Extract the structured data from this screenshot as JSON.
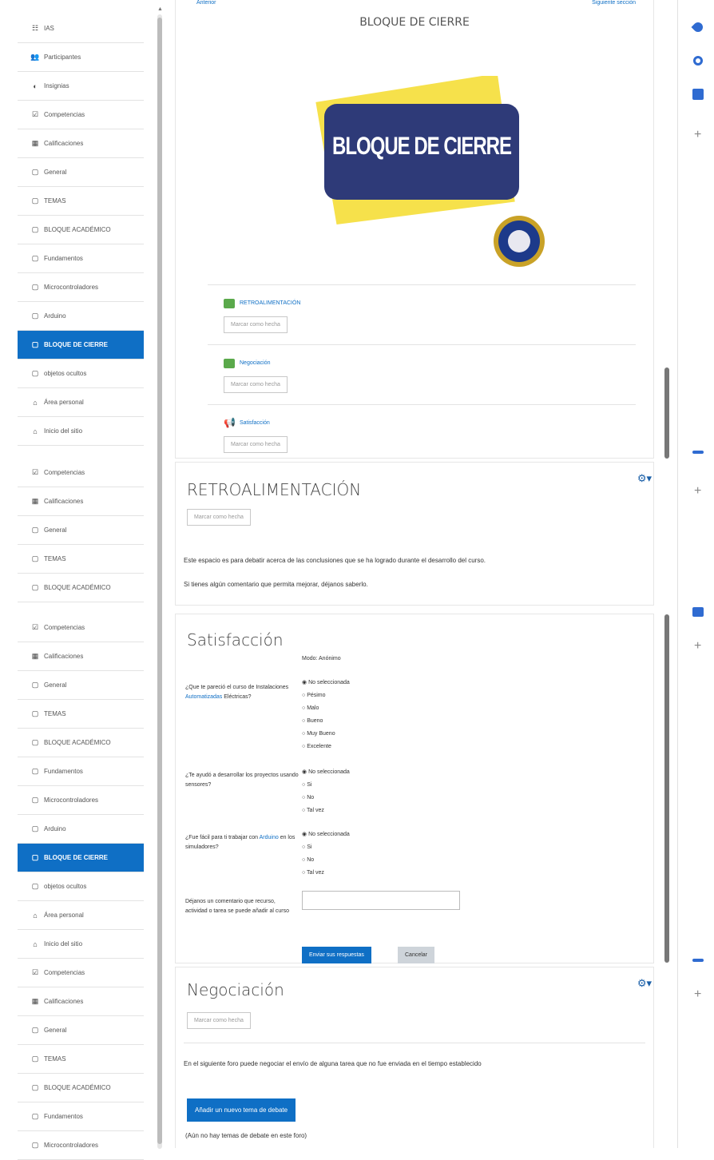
{
  "sidebar1": {
    "items": [
      {
        "icon": "☷",
        "label": "IAS"
      },
      {
        "icon": "👥",
        "label": "Participantes"
      },
      {
        "icon": "◐",
        "label": "Insignias"
      },
      {
        "icon": "☑",
        "label": "Competencias"
      },
      {
        "icon": "▦",
        "label": "Calificaciones"
      },
      {
        "icon": "▢",
        "label": "General"
      },
      {
        "icon": "▢",
        "label": "TEMAS"
      },
      {
        "icon": "▢",
        "label": "BLOQUE ACADÉMICO"
      },
      {
        "icon": "▢",
        "label": "Fundamentos"
      },
      {
        "icon": "▢",
        "label": "Microcontroladores"
      },
      {
        "icon": "▢",
        "label": "Arduino"
      },
      {
        "icon": "▢",
        "label": "BLOQUE DE CIERRE"
      },
      {
        "icon": "▢",
        "label": "objetos ocultos"
      },
      {
        "icon": "⌂",
        "label": "Área personal"
      },
      {
        "icon": "⌂",
        "label": "Inicio del sitio"
      }
    ]
  },
  "sidebar2": {
    "items": [
      {
        "icon": "☑",
        "label": "Competencias"
      },
      {
        "icon": "▦",
        "label": "Calificaciones"
      },
      {
        "icon": "▢",
        "label": "General"
      },
      {
        "icon": "▢",
        "label": "TEMAS"
      },
      {
        "icon": "▢",
        "label": "BLOQUE ACADÉMICO"
      }
    ]
  },
  "sidebar3": {
    "items": [
      {
        "icon": "☑",
        "label": "Competencias"
      },
      {
        "icon": "▦",
        "label": "Calificaciones"
      },
      {
        "icon": "▢",
        "label": "General"
      },
      {
        "icon": "▢",
        "label": "TEMAS"
      },
      {
        "icon": "▢",
        "label": "BLOQUE ACADÉMICO"
      },
      {
        "icon": "▢",
        "label": "Fundamentos"
      },
      {
        "icon": "▢",
        "label": "Microcontroladores"
      },
      {
        "icon": "▢",
        "label": "Arduino"
      },
      {
        "icon": "▢",
        "label": "BLOQUE DE CIERRE"
      },
      {
        "icon": "▢",
        "label": "objetos ocultos"
      },
      {
        "icon": "⌂",
        "label": "Área personal"
      },
      {
        "icon": "⌂",
        "label": "Inicio del sitio"
      },
      {
        "icon": "☑",
        "label": "Competencias"
      },
      {
        "icon": "▦",
        "label": "Calificaciones"
      },
      {
        "icon": "▢",
        "label": "General"
      },
      {
        "icon": "▢",
        "label": "TEMAS"
      },
      {
        "icon": "▢",
        "label": "BLOQUE ACADÉMICO"
      },
      {
        "icon": "▢",
        "label": "Fundamentos"
      },
      {
        "icon": "▢",
        "label": "Microcontroladores"
      }
    ]
  },
  "section": {
    "title": "BLOQUE DE CIERRE",
    "banner_text": "BLOQUE DE CIERRE",
    "activities": [
      {
        "name": "RETROALIMENTACIÓN",
        "button": "Marcar como hecha"
      },
      {
        "name": "Negociación",
        "button": "Marcar como hecha"
      },
      {
        "name": "Satisfacción",
        "button": "Marcar como hecha"
      }
    ]
  },
  "retro": {
    "title": "RETROALIMENTACIÓN",
    "button": "Marcar como hecha",
    "p1": "Este espacio es para debatir acerca de las conclusiones que se ha logrado durante el desarrollo del curso.",
    "p2": "Si tienes algún comentario que permita mejorar, déjanos saberlo."
  },
  "satis": {
    "title": "Satisfacción",
    "mode": "Modo: Anónimo",
    "q1": {
      "pre": "¿Que te pareció el curso de Instalaciones ",
      "link": "Automatizadas",
      "post": " Eléctricas?",
      "options": [
        "No seleccionada",
        "Pésimo",
        "Malo",
        "Bueno",
        "Muy Bueno",
        "Excelente"
      ]
    },
    "q2": {
      "text": "¿Te ayudó a desarrollar los proyectos usando sensores?",
      "options": [
        "No seleccionada",
        "Si",
        "No",
        "Tal vez"
      ]
    },
    "q3": {
      "pre": "¿Fue fácil para ti trabajar con ",
      "link": "Arduino",
      "post": " en los simuladores?",
      "options": [
        "No seleccionada",
        "Si",
        "No",
        "Tal vez"
      ]
    },
    "q4": {
      "text": "Déjanos un comentario que recurso, actividad o tarea se puede añadir al curso"
    },
    "submit": "Enviar sus respuestas",
    "cancel": "Cancelar"
  },
  "nego": {
    "title": "Negociación",
    "button": "Marcar como hecha",
    "p1": "En el siguiente foro puede negociar el envío de alguna tarea que no fue enviada en el tiempo establecido",
    "add": "Añadir un nuevo tema de debate",
    "empty": "(Aún no hay temas de debate en este foro)"
  },
  "colors": {
    "accent": "#0f6fc5",
    "banner": "#2e3a78",
    "banner_accent": "#f6e14b"
  }
}
